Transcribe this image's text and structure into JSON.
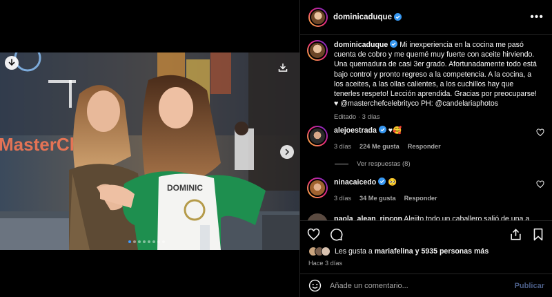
{
  "post": {
    "username": "dominicaduque",
    "caption_text": "Mi inexperiencia en la cocina me pasó cuenta de cobro y me quemé muy fuerte con aceite hirviendo. Una quemadura de casi 3er grado. Afortunadamente todo está bajo control y pronto regreso a la competencia. A la cocina, a los aceites, a las ollas calientes, a los cuchillos hay que tenerles respeto! Lección aprendida. Gracias por preocuparse! ♥",
    "caption_mentions": "@masterchefcelebrityco PH: @candelariaphotos",
    "caption_meta": "Editado · 3 días",
    "photo_text": "DOMINIC",
    "photo_sign": "MasterCh",
    "carousel_count": 8,
    "carousel_active": 1
  },
  "comments": [
    {
      "username": "alejoestrada",
      "verified": true,
      "text": "♥🥰",
      "age": "3 días",
      "likes": "224 Me gusta",
      "reply_label": "Responder",
      "view_replies": "Ver respuestas (8)"
    },
    {
      "username": "ninacaicedo",
      "verified": true,
      "text": "🥺",
      "age": "3 días",
      "likes": "34 Me gusta",
      "reply_label": "Responder"
    },
    {
      "username": "paola_alean_rincon",
      "verified": false,
      "text": "Alejito todo un caballero salió de una a"
    }
  ],
  "likes": {
    "prefix": "Les gusta a ",
    "user": "mariafelina",
    "suffix": " y 5935 personas más"
  },
  "time_ago": "Hace 3 días",
  "add_comment": {
    "placeholder": "Añade un comentario...",
    "publish_label": "Publicar"
  },
  "colors": {
    "verified": "#3797f0",
    "accent_link": "#4a5d86",
    "carousel_active": "#3d9aff"
  },
  "icons": [
    "download-icon",
    "save-photo-icon",
    "chevron-right-icon",
    "verified-icon",
    "more-icon",
    "heart-icon",
    "comment-icon",
    "share-icon",
    "bookmark-icon",
    "emoji-icon"
  ]
}
